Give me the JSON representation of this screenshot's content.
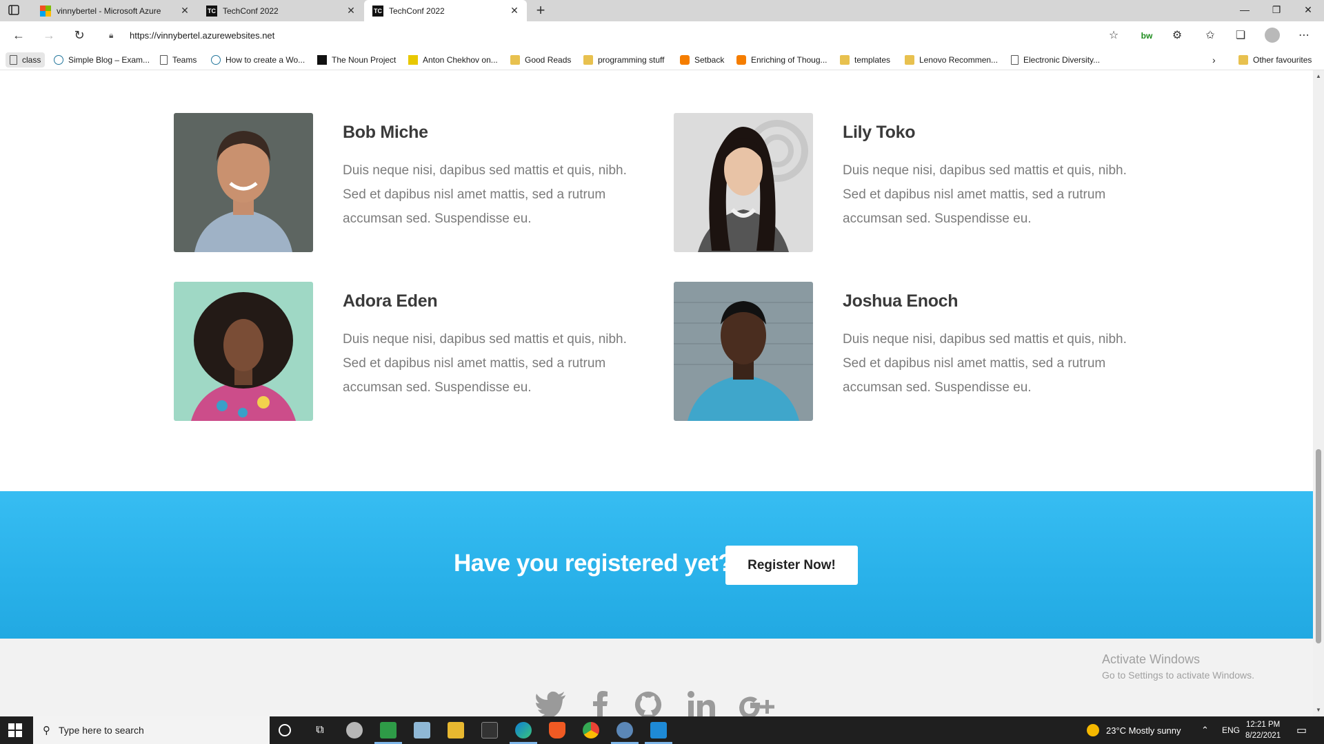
{
  "browser": {
    "tabs": [
      {
        "title": "vinnybertel - Microsoft Azure",
        "favicon": "microsoft-logo"
      },
      {
        "title": "TechConf 2022",
        "favicon": "tc-logo"
      },
      {
        "title": "TechConf 2022",
        "favicon": "tc-logo",
        "active": true
      }
    ],
    "url": "https://vinnybertel.azurewebsites.net",
    "favorites": [
      {
        "label": "class",
        "icon": "page-icon"
      },
      {
        "label": "Simple Blog – Exam...",
        "icon": "wordpress-icon"
      },
      {
        "label": "Teams",
        "icon": "page-icon"
      },
      {
        "label": "How to create a Wo...",
        "icon": "wordpress-icon"
      },
      {
        "label": "The Noun Project",
        "icon": "noun-project-icon"
      },
      {
        "label": "Anton Chekhov on...",
        "icon": "bookmark-icon"
      },
      {
        "label": "Good Reads",
        "icon": "folder-icon"
      },
      {
        "label": "programming stuff",
        "icon": "folder-icon"
      },
      {
        "label": "Setback",
        "icon": "blogger-icon"
      },
      {
        "label": "Enriching of Thoug...",
        "icon": "blogger-icon"
      },
      {
        "label": "templates",
        "icon": "folder-icon"
      },
      {
        "label": "Lenovo Recommen...",
        "icon": "folder-icon"
      },
      {
        "label": "Electronic Diversity...",
        "icon": "page-icon"
      }
    ],
    "other_favourites": "Other favourites"
  },
  "speakers": [
    {
      "name": "Bob Miche",
      "bio": "Duis neque nisi, dapibus sed mattis et quis, nibh. Sed et dapibus nisl amet mattis, sed a rutrum accumsan sed. Suspendisse eu."
    },
    {
      "name": "Lily Toko",
      "bio": "Duis neque nisi, dapibus sed mattis et quis, nibh. Sed et dapibus nisl amet mattis, sed a rutrum accumsan sed. Suspendisse eu."
    },
    {
      "name": "Adora Eden",
      "bio": "Duis neque nisi, dapibus sed mattis et quis, nibh. Sed et dapibus nisl amet mattis, sed a rutrum accumsan sed. Suspendisse eu."
    },
    {
      "name": "Joshua Enoch",
      "bio": "Duis neque nisi, dapibus sed mattis et quis, nibh. Sed et dapibus nisl amet mattis, sed a rutrum accumsan sed. Suspendisse eu."
    }
  ],
  "cta": {
    "text": "Have you registered yet?",
    "button": "Register Now!"
  },
  "footer": {
    "social": [
      "twitter-icon",
      "facebook-icon",
      "github-icon",
      "linkedin-icon",
      "google-plus-icon"
    ],
    "activate_title": "Activate Windows",
    "activate_sub": "Go to Settings to activate Windows."
  },
  "taskbar": {
    "search_placeholder": "Type here to search",
    "weather": "23°C  Mostly sunny",
    "language": "ENG",
    "time": "12:21 PM",
    "date": "8/22/2021"
  },
  "colors": {
    "cta_blue": "#2ab2ea",
    "footer_bg": "#f2f2f2",
    "taskbar": "#1f1f1f"
  }
}
